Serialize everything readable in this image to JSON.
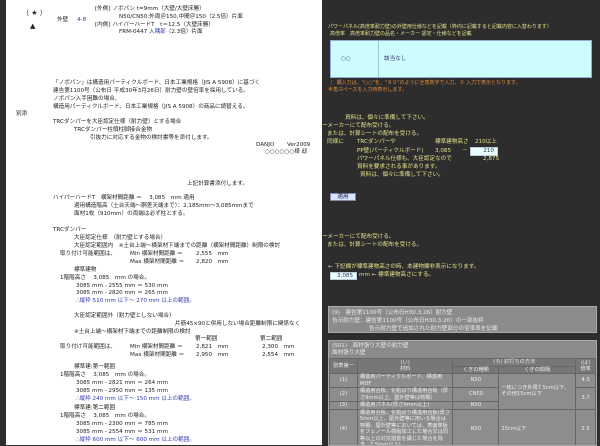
{
  "left": {
    "mark_star": "（ ★ ）",
    "mark_triangle": "▲",
    "wall_label": "外壁",
    "wall_code": "4-8",
    "outer_spec": "[外側] ノボパン t=9mm（大壁/大壁床勝）",
    "outer_nail": "N50/CN50:外周＠150,中間＠150（2.5倍）片面",
    "inner_spec": "[内側] ハイパーハードT　t＝12.5（大壁床勝）",
    "inner_nail_prefix": "FRM-0447",
    "inner_nail_blue": "入隅部",
    "inner_nail_suffix": "（2.3倍）片面",
    "para": [
      "「ノボパン」は構造用パーティクルボード、日本工業規格（JIS A 5908）に基づく",
      "建告第1100号（公布日 平成30年3月26日）耐力壁の壁倍率を採用している。",
      "ノボパン入手困難の場合、",
      "構造用パーティクルボード、日本工業規格（JIS A 5908）の商品に読替える。"
    ],
    "attachment": "別添",
    "trc_lines": [
      "TRCダンパーを大臣認定仕様（耐力壁）とする場合",
      "TRCダンパー柱頭柱脚接合金物",
      "引抜力に対応する金物の検討書等を添付します。"
    ],
    "maker": "DANJO",
    "version": "Ver2009",
    "client": "○○○○○○様 邸",
    "attach_note": "上記計算書添付します。",
    "hyper": [
      "ハイパーハードT　横架材間距離 ＝　 3,085　mm 適用",
      "適用構造階高（土台天端～胴差天端まで）：2,185mm～3,085mmまで",
      "面材1枚（910mm）の両端は必ず柱とする。"
    ],
    "trc_title": "TRCダンパー",
    "trc_cert": [
      "大臣認定仕様　（耐力壁とする場合）",
      "大臣認定範囲内　※土台上端～横架材下端までの距離（横架材間距離）制限の検討"
    ],
    "range_label": "取り付け可能範囲は、",
    "min_label": "Min 横架材間距離 ＝",
    "min_val": "2,555　mm",
    "max_label": "Max 横架材間距離 ＝",
    "max_val": "2,820　mm",
    "std_title": "標準建物",
    "std_height": "1階階高さ　 3,085　mm の場合。",
    "std_calc": [
      "3085 mm - 2555 mm ＝ 530 mm",
      "3085 mm - 2820 mm ＝ 265 mm"
    ],
    "std_result": "∴縦枠 510 mm 以下～ 270 mm 以上の範囲。",
    "out_title": "大臣認定範囲外（耐力壁としない場合）",
    "out_note": "片筋45×90と併用しない場合距離制限に関係なく",
    "out_check": "※土台上端～横架材下端までの距離制限の検討",
    "range1": "第一範囲",
    "range2": "第二範囲",
    "out_min": [
      "2,821　mm",
      "2,300　mm"
    ],
    "out_max": [
      "2,950　mm",
      "2,554　mm"
    ],
    "r1_title": "標準建:第一範囲",
    "r1_calc": [
      "3085 mm - 2821 mm ＝ 264 mm",
      "3085 mm - 2950 mm ＝ 135 mm"
    ],
    "r1_result": "∴縦枠 240 mm 以下～ 150 mm 以上の範囲。",
    "r2_title": "標準建:第二範囲",
    "r2_calc": [
      "3085 mm - 2300 mm ＝ 785 mm",
      "3085 mm - 2554 mm ＝ 531 mm"
    ],
    "r2_result": "∴縦枠 600 mm 以下～ 600 mm 以上の範囲。"
  },
  "right": {
    "head1": "パワーパネル(高倍率耐力壁)の外壁用仕様などを記載（枠内に記載すると記載内容に入替わります）",
    "head2": "高倍率　高倍率耐力壁の品名・メーカー 認定・仕様などを記載",
    "code": "○○",
    "code_text": "該当なし",
    "note1": "！ 欄入力は、\"○○\"を、\"８０\"のように全角数字で入力、０ 入力で表示となります。",
    "note2": "半角スペースを入力時表示します。",
    "info": [
      "資料は、個々に準備して下さい。",
      "ーメーカーにて配布受ける。",
      "または、計算シートの配布を受ける。"
    ],
    "same": "同様に",
    "trc": "TRCダンパーや",
    "std_height_label": "標準建物高さ",
    "over210": "210以上",
    "pp": "PP壁(パーティクルボード)",
    "pp_val": "3,085",
    "dash": "－",
    "pp_input": "210",
    "power": "パワーパネル仕様も、大臣認定なので",
    "power_val": "2,875",
    "req": "資料を要求される事があります。",
    "prep": "資料は、個々に準備して下さい。",
    "apply": "適用",
    "maker2": "ーメーカーにて配布受ける。",
    "calc2": "または、計算シートの配布を受ける。",
    "below_note": "← 下記欄が標準建物高さの時、本建物欄非表示になります。",
    "height_input": "3,085",
    "height_suffix": "mm ← 標準建物高さにする。",
    "box9": [
      "(9)　建告第1100号（公布日H30.3.26）耐力壁",
      "告示耐力壁：建告第1100号（公布日H30.3.26）の一部抜粋",
      "告示耐力壁で追加された耐力壁部分の倍率表を記載"
    ],
    "s01_title": "(S01)　面材張り大壁の耐力壁",
    "s01_sub": "面材張り大壁",
    "table": {
      "h_table": "別表第一",
      "h_material": "(い)\n材料",
      "h_method": "(ろ) 釘打ちの方法",
      "h_rate": "(は)\n倍率",
      "h_nail": "くぎの種類",
      "h_interval": "くぎの間隔",
      "rows": [
        {
          "no": "(1)",
          "material": "構造用パーティクルボード、構造用MDF",
          "nail": "N50",
          "rate": "4.3"
        },
        {
          "no": "(2)",
          "material": "構造用合板、化粧ばり構造用合板（厚さ9mm以上、屋外壁等は特類）",
          "nail": "CN50",
          "rate": "3.7"
        },
        {
          "no": "(3)",
          "material": "構造用パネル(厚さ9mm以上)",
          "nail": "N50"
        },
        {
          "no": "(4)",
          "material": "構造用合板、化粧ばり構造用合板(厚さ5mm以上、屋外壁等に用いる場合は特類、屋外壁等においては、表面単板をフェノール樹脂加工した場合又は同等以上の対抗措置を講じた場合を除き、7.5mm以上)",
          "nail": "N50",
          "rate": "2.5"
        }
      ],
      "interval_a": "一枚につき外周7.5cm以下、その他15cm以下",
      "interval_b": "15cm以下"
    }
  }
}
